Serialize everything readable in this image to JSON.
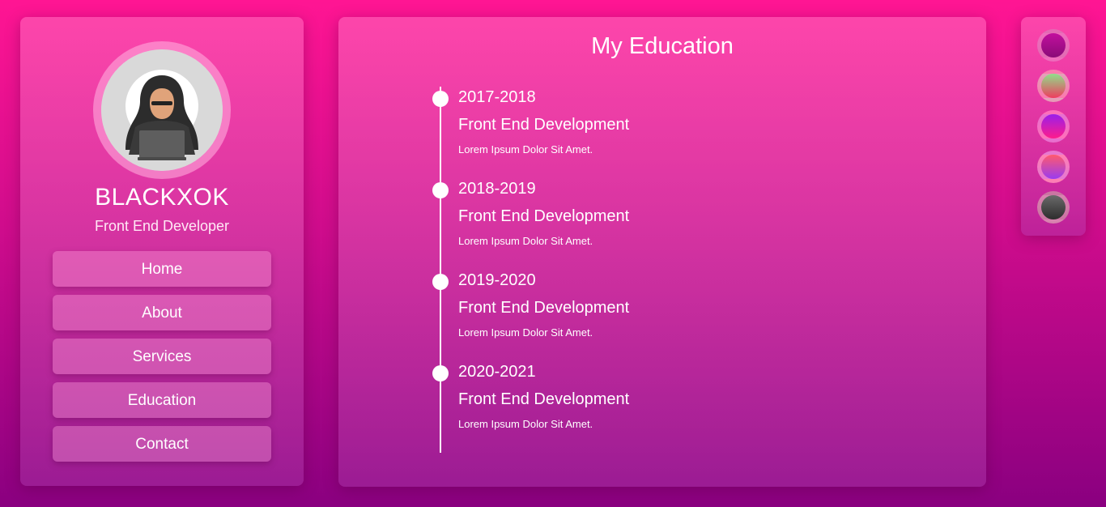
{
  "profile": {
    "name": "BLACKXOK",
    "role": "Front End Developer",
    "avatar_icon": "hacker-avatar-icon"
  },
  "nav": {
    "items": [
      {
        "label": "Home"
      },
      {
        "label": "About"
      },
      {
        "label": "Services"
      },
      {
        "label": "Education"
      },
      {
        "label": "Contact"
      }
    ]
  },
  "education": {
    "title": "My Education",
    "items": [
      {
        "year": "2017-2018",
        "course": "Front End Development",
        "desc": "Lorem Ipsum Dolor Sit Amet."
      },
      {
        "year": "2018-2019",
        "course": "Front End Development",
        "desc": "Lorem Ipsum Dolor Sit Amet."
      },
      {
        "year": "2019-2020",
        "course": "Front End Development",
        "desc": "Lorem Ipsum Dolor Sit Amet."
      },
      {
        "year": "2020-2021",
        "course": "Front End Development",
        "desc": "Lorem Ipsum Dolor Sit Amet."
      }
    ]
  },
  "themes": {
    "swatches": [
      {
        "colors": [
          "#c20f9e",
          "#8a0b78"
        ]
      },
      {
        "colors": [
          "#8fe08a",
          "#ee3e5f"
        ]
      },
      {
        "colors": [
          "#9a1fea",
          "#ff1c8c"
        ]
      },
      {
        "colors": [
          "#ff5a6e",
          "#9a3cf0"
        ]
      },
      {
        "colors": [
          "#6a6a6a",
          "#2d2d2d"
        ]
      }
    ]
  },
  "colors": {
    "background_top": "#ff1593",
    "background_bottom": "#8a0080",
    "accent": "#ffffff"
  }
}
